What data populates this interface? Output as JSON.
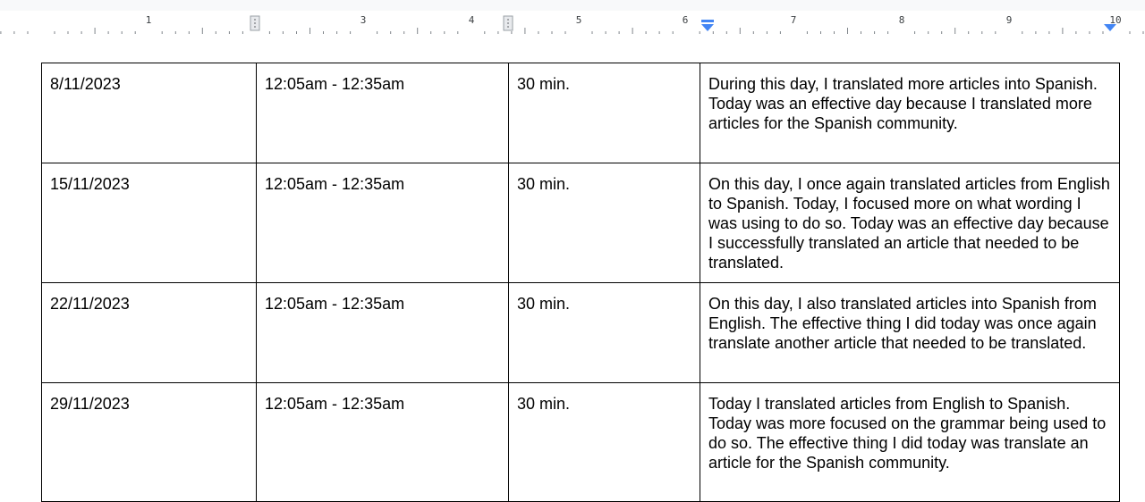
{
  "ruler": {
    "numbers": [
      "1",
      "3",
      "4",
      "5",
      "6",
      "7",
      "8",
      "9",
      "10"
    ]
  },
  "colors": {
    "indent_marker": "#4285f4",
    "tab_stop": "#9aa0a6",
    "table_border": "#000000"
  },
  "log": {
    "rows": [
      {
        "date": "8/11/2023",
        "time": "12:05am - 12:35am",
        "duration": "30 min.",
        "notes": "During this day, I translated more articles into Spanish. Today was an effective day because I translated more articles for the Spanish community."
      },
      {
        "date": "15/11/2023",
        "time": "12:05am - 12:35am",
        "duration": "30 min.",
        "notes": "On this day, I once again translated articles from English to Spanish. Today, I focused more on what wording I was using to do so. Today was an effective day because I successfully translated an article that needed to be translated."
      },
      {
        "date": "22/11/2023",
        "time": "12:05am - 12:35am",
        "duration": "30 min.",
        "notes": "On this day, I also translated articles into Spanish from English. The effective thing I did today was once again translate another article that needed to be translated."
      },
      {
        "date": "29/11/2023",
        "time": "12:05am - 12:35am",
        "duration": "30 min.",
        "notes": "Today I translated articles from English to Spanish. Today was more focused on the grammar being used to do so. The effective thing I did today was translate an article for the Spanish community."
      }
    ]
  }
}
